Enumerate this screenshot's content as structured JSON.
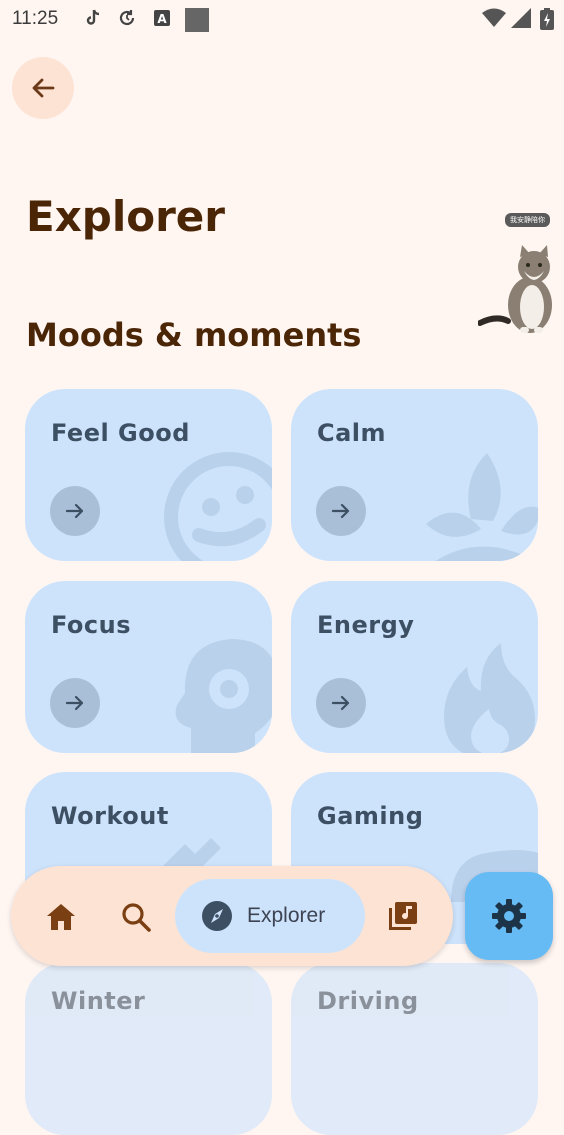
{
  "status_bar": {
    "time": "11:25",
    "icons": [
      "tiktok-icon",
      "sync-icon",
      "font-a-icon",
      "square-icon",
      "wifi-icon",
      "signal-icon",
      "battery-icon"
    ]
  },
  "header": {
    "back_icon": "arrow-left-icon",
    "title": "Explorer"
  },
  "section": {
    "title": "Moods & moments"
  },
  "overlay": {
    "badge_text": "我安静陪你"
  },
  "cards": [
    {
      "label": "Feel Good",
      "decoration": "smiley-icon"
    },
    {
      "label": "Calm",
      "decoration": "leaves-icon"
    },
    {
      "label": "Focus",
      "decoration": "head-gear-icon"
    },
    {
      "label": "Energy",
      "decoration": "flame-icon"
    },
    {
      "label": "Workout",
      "decoration": "dumbbell-icon"
    },
    {
      "label": "Gaming",
      "decoration": "gamepad-icon"
    },
    {
      "label": "Winter",
      "decoration": ""
    },
    {
      "label": "Driving",
      "decoration": ""
    }
  ],
  "nav": {
    "home_icon": "home-icon",
    "search_icon": "search-icon",
    "explorer_label": "Explorer",
    "explorer_icon": "compass-icon",
    "library_icon": "library-music-icon",
    "settings_icon": "gear-icon"
  },
  "colors": {
    "background": "#fff6f2",
    "card": "#cde3fb",
    "title": "#4a2506",
    "nav": "#fde3d4",
    "fab": "#66bbf5"
  }
}
